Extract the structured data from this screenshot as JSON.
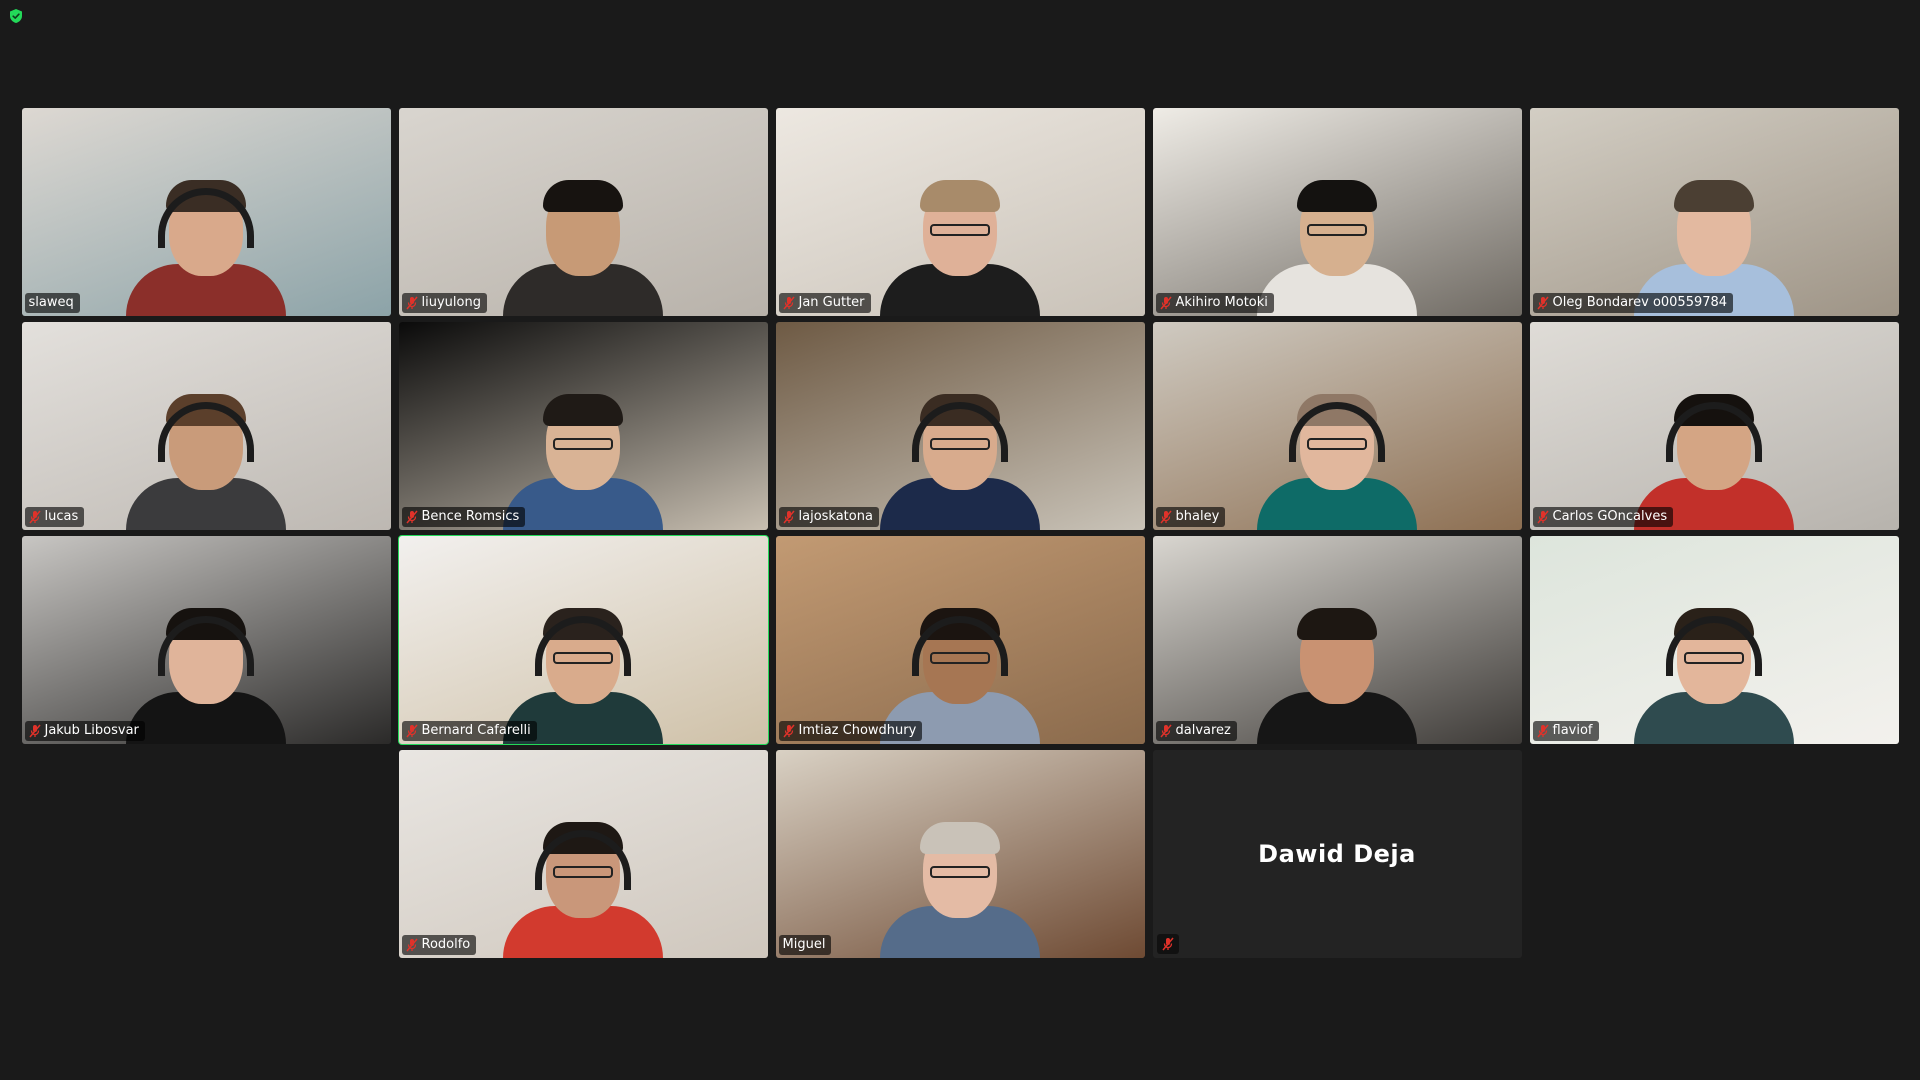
{
  "meeting": {
    "security_icon": "shield-check-icon",
    "accent_color": "#23d959",
    "muted_color": "#e0322a"
  },
  "rows": [
    [
      {
        "name": "slaweq",
        "muted": false,
        "active": false,
        "bg": [
          "#ddd8d2",
          "#8ca3a8"
        ],
        "skin": "#d9a98b",
        "hair": "#3a2d24",
        "shirt": "#8b2f2a",
        "headset": true,
        "glasses": false
      },
      {
        "name": "liuyulong",
        "muted": true,
        "active": false,
        "bg": [
          "#d9d5cf",
          "#b8b2aa"
        ],
        "skin": "#c79a76",
        "hair": "#171310",
        "shirt": "#2e2b29",
        "headset": false,
        "glasses": false
      },
      {
        "name": "Jan Gutter",
        "muted": true,
        "active": false,
        "bg": [
          "#ede8e1",
          "#c9c2b8"
        ],
        "skin": "#dfb198",
        "hair": "#a88b6a",
        "shirt": "#1d1d1d",
        "headset": false,
        "glasses": true
      },
      {
        "name": "Akihiro Motoki",
        "muted": true,
        "active": false,
        "bg": [
          "#efece6",
          "#6f6a63"
        ],
        "skin": "#d6b08f",
        "hair": "#141210",
        "shirt": "#e6e3de",
        "headset": false,
        "glasses": true
      },
      {
        "name": "Oleg Bondarev o00559784",
        "muted": true,
        "active": false,
        "bg": [
          "#d3cec4",
          "#9e9486"
        ],
        "skin": "#e3b9a0",
        "hair": "#4b3f33",
        "shirt": "#a7bfdc",
        "headset": false,
        "glasses": false
      }
    ],
    [
      {
        "name": "lucas",
        "muted": true,
        "active": false,
        "bg": [
          "#e3e0dc",
          "#bdb8b2"
        ],
        "skin": "#c99b7a",
        "hair": "#5b3f2b",
        "shirt": "#3b3b3d",
        "headset": true,
        "glasses": false
      },
      {
        "name": "Bence Romsics",
        "muted": true,
        "active": false,
        "bg": [
          "#0a0a0a",
          "#c8bfb1"
        ],
        "skin": "#d9b395",
        "hair": "#1f1a16",
        "shirt": "#385a8a",
        "headset": false,
        "glasses": true
      },
      {
        "name": "lajoskatona",
        "muted": true,
        "active": false,
        "bg": [
          "#6e5a44",
          "#c9c3b8"
        ],
        "skin": "#d8ab8d",
        "hair": "#3a2c22",
        "shirt": "#1c2a4a",
        "headset": true,
        "glasses": true
      },
      {
        "name": "bhaley",
        "muted": true,
        "active": false,
        "bg": [
          "#cfcac1",
          "#8d6f52"
        ],
        "skin": "#e1b79d",
        "hair": "#8f7866",
        "shirt": "#0e6b67",
        "headset": true,
        "glasses": true
      },
      {
        "name": "Carlos GOncalves",
        "muted": true,
        "active": false,
        "bg": [
          "#dfdcd7",
          "#b7b3ad"
        ],
        "skin": "#d4a584",
        "hair": "#15110e",
        "shirt": "#c2302a",
        "headset": true,
        "glasses": false
      }
    ],
    [
      {
        "name": "Jakub Libosvar",
        "muted": true,
        "active": false,
        "bg": [
          "#c8c6c3",
          "#2b2a29"
        ],
        "skin": "#e0b49a",
        "hair": "#16120f",
        "shirt": "#141414",
        "headset": true,
        "glasses": false
      },
      {
        "name": "Bernard Cafarelli",
        "muted": true,
        "active": true,
        "bg": [
          "#f2f0ee",
          "#cfc1a8"
        ],
        "skin": "#d9ab8c",
        "hair": "#2a221d",
        "shirt": "#1f3a3a",
        "headset": true,
        "glasses": true
      },
      {
        "name": "Imtiaz Chowdhury",
        "muted": true,
        "active": false,
        "bg": [
          "#c29a73",
          "#8a6a4c"
        ],
        "skin": "#a67653",
        "hair": "#1b1410",
        "shirt": "#8d9bb0",
        "headset": true,
        "glasses": true
      },
      {
        "name": "dalvarez",
        "muted": true,
        "active": false,
        "bg": [
          "#d9d6d0",
          "#3e3b38"
        ],
        "skin": "#c99272",
        "hair": "#1d1712",
        "shirt": "#161616",
        "headset": false,
        "glasses": false
      },
      {
        "name": "flaviof",
        "muted": true,
        "active": false,
        "bg": [
          "#dde5dc",
          "#f3f1ed"
        ],
        "skin": "#e3b69b",
        "hair": "#2a2119",
        "shirt": "#2f4b4f",
        "headset": true,
        "glasses": true
      }
    ],
    [
      {
        "name": "Rodolfo",
        "muted": true,
        "active": false,
        "bg": [
          "#e9e6e2",
          "#cfc7bd"
        ],
        "skin": "#c9977a",
        "hair": "#1e1814",
        "shirt": "#d23a2e",
        "headset": true,
        "glasses": true
      },
      {
        "name": "Miguel",
        "muted": false,
        "active": false,
        "bg": [
          "#d9d1c4",
          "#6e4a33"
        ],
        "skin": "#e4bba5",
        "hair": "#c9c2b8",
        "shirt": "#556c8a",
        "headset": false,
        "glasses": true
      },
      {
        "name": "Dawid Deja",
        "muted": true,
        "active": false,
        "video_off": true
      }
    ]
  ]
}
